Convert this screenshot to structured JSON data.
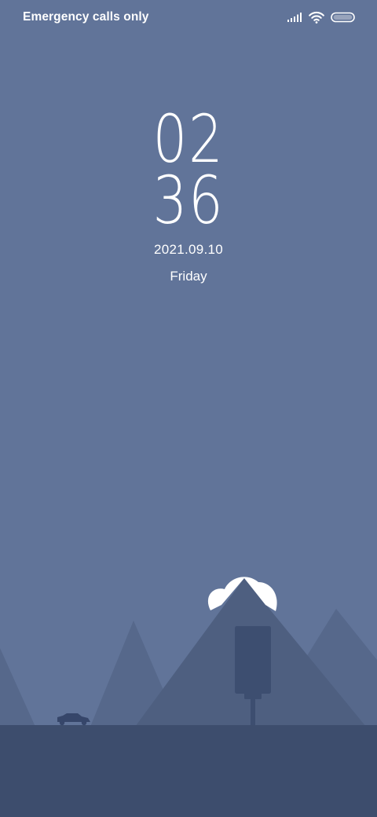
{
  "status_bar": {
    "carrier_text": "Emergency calls only",
    "icons": [
      "signal-icon",
      "wifi-icon",
      "battery-icon"
    ]
  },
  "clock": {
    "hours": "02",
    "minutes": "36",
    "date": "2021.09.10",
    "weekday": "Friday"
  },
  "wallpaper": {
    "scene": [
      "mountain-icon",
      "cloud-icon",
      "car-icon",
      "tree-icon"
    ],
    "colors": {
      "sky": "#617499",
      "ground": "#3d4d6d",
      "mountain_light": "#56688b",
      "mountain_mid": "#4e5f80",
      "tree": "#3d4e70",
      "cloud": "#ffffff"
    }
  }
}
